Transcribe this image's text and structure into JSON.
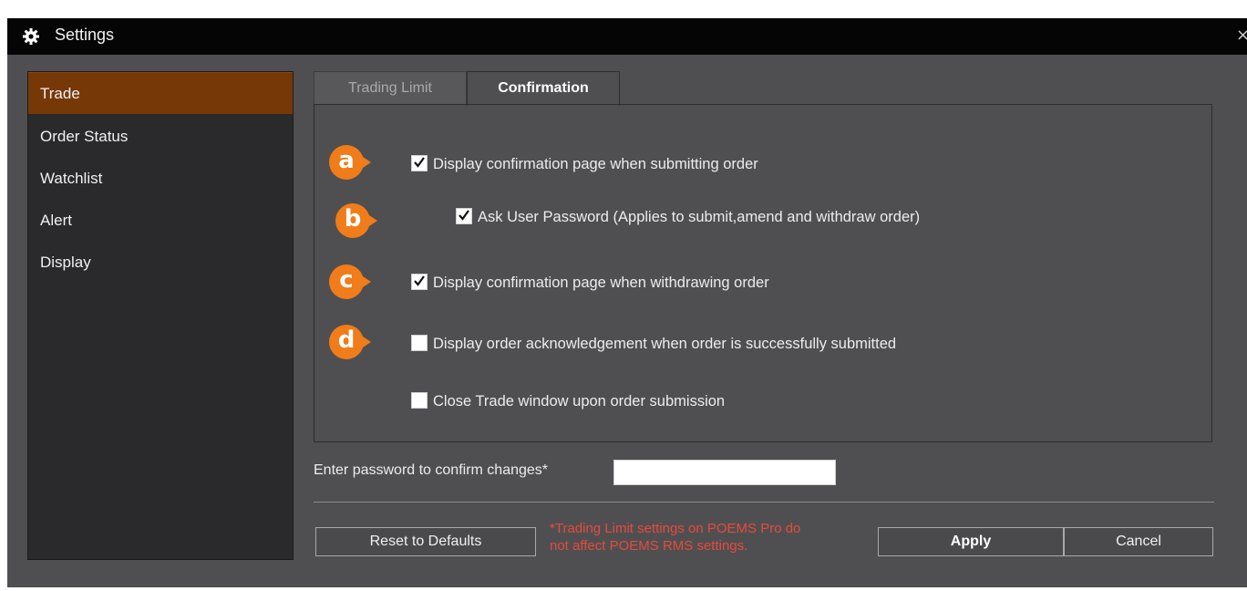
{
  "window": {
    "title": "Settings",
    "title_icon": "gear-icon",
    "close_glyph": "×"
  },
  "sidebar": {
    "items": [
      {
        "label": "Trade",
        "active": true
      },
      {
        "label": "Order Status",
        "active": false
      },
      {
        "label": "Watchlist",
        "active": false
      },
      {
        "label": "Alert",
        "active": false
      },
      {
        "label": "Display",
        "active": false
      }
    ]
  },
  "tabs": [
    {
      "label": "Trading Limit",
      "active": false
    },
    {
      "label": "Confirmation",
      "active": true
    }
  ],
  "options": [
    {
      "badge": "a",
      "label": "Display confirmation page when submitting order",
      "checked": true
    },
    {
      "badge": "b",
      "label": "Ask User Password (Applies to submit,amend and withdraw order)",
      "checked": true
    },
    {
      "badge": "c",
      "label": "Display confirmation page when withdrawing order",
      "checked": true
    },
    {
      "badge": "d",
      "label": "Display order acknowledgement when order is successfully submitted",
      "checked": false
    },
    {
      "badge": "",
      "label": "Close Trade window upon order submission",
      "checked": false
    }
  ],
  "password": {
    "label": "Enter password to confirm changes*",
    "value": ""
  },
  "note": {
    "line1": "*Trading Limit settings on POEMS Pro do",
    "line2": "not affect POEMS RMS settings."
  },
  "buttons": {
    "reset": "Reset to Defaults",
    "apply": "Apply",
    "cancel": "Cancel"
  },
  "colors": {
    "accent_badge": "#f07c1a",
    "active_sidebar": "#773808",
    "note_text": "#e84a3a"
  }
}
